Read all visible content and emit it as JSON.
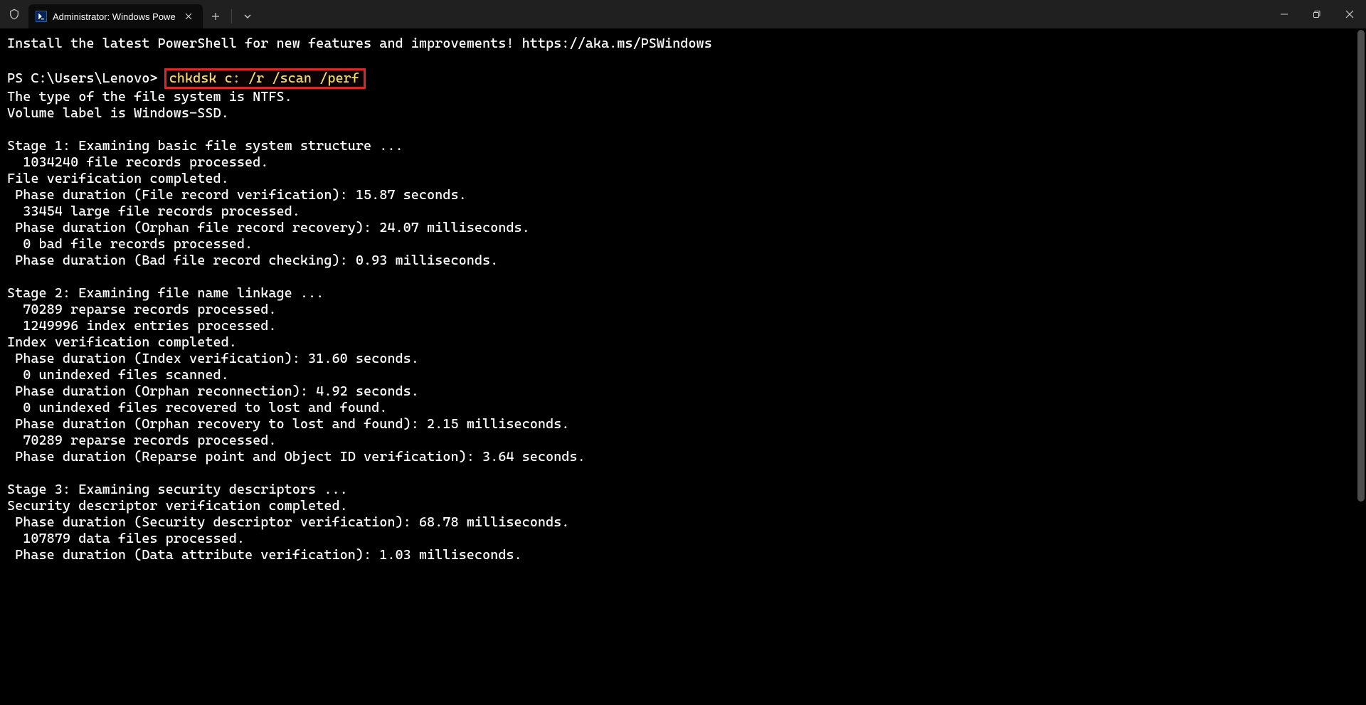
{
  "titlebar": {
    "tab_title": "Administrator: Windows Powe",
    "tab_icon_glyph": ">_"
  },
  "terminal": {
    "banner": "Install the latest PowerShell for new features and improvements! https://aka.ms/PSWindows",
    "prompt": "PS C:\\Users\\Lenovo>",
    "command": "chkdsk c: /r /scan /perf",
    "lines": [
      "The type of the file system is NTFS.",
      "Volume label is Windows-SSD.",
      "",
      "Stage 1: Examining basic file system structure ...",
      "  1034240 file records processed.",
      "File verification completed.",
      " Phase duration (File record verification): 15.87 seconds.",
      "  33454 large file records processed.",
      " Phase duration (Orphan file record recovery): 24.07 milliseconds.",
      "  0 bad file records processed.",
      " Phase duration (Bad file record checking): 0.93 milliseconds.",
      "",
      "Stage 2: Examining file name linkage ...",
      "  70289 reparse records processed.",
      "  1249996 index entries processed.",
      "Index verification completed.",
      " Phase duration (Index verification): 31.60 seconds.",
      "  0 unindexed files scanned.",
      " Phase duration (Orphan reconnection): 4.92 seconds.",
      "  0 unindexed files recovered to lost and found.",
      " Phase duration (Orphan recovery to lost and found): 2.15 milliseconds.",
      "  70289 reparse records processed.",
      " Phase duration (Reparse point and Object ID verification): 3.64 seconds.",
      "",
      "Stage 3: Examining security descriptors ...",
      "Security descriptor verification completed.",
      " Phase duration (Security descriptor verification): 68.78 milliseconds.",
      "  107879 data files processed.",
      " Phase duration (Data attribute verification): 1.03 milliseconds."
    ]
  }
}
